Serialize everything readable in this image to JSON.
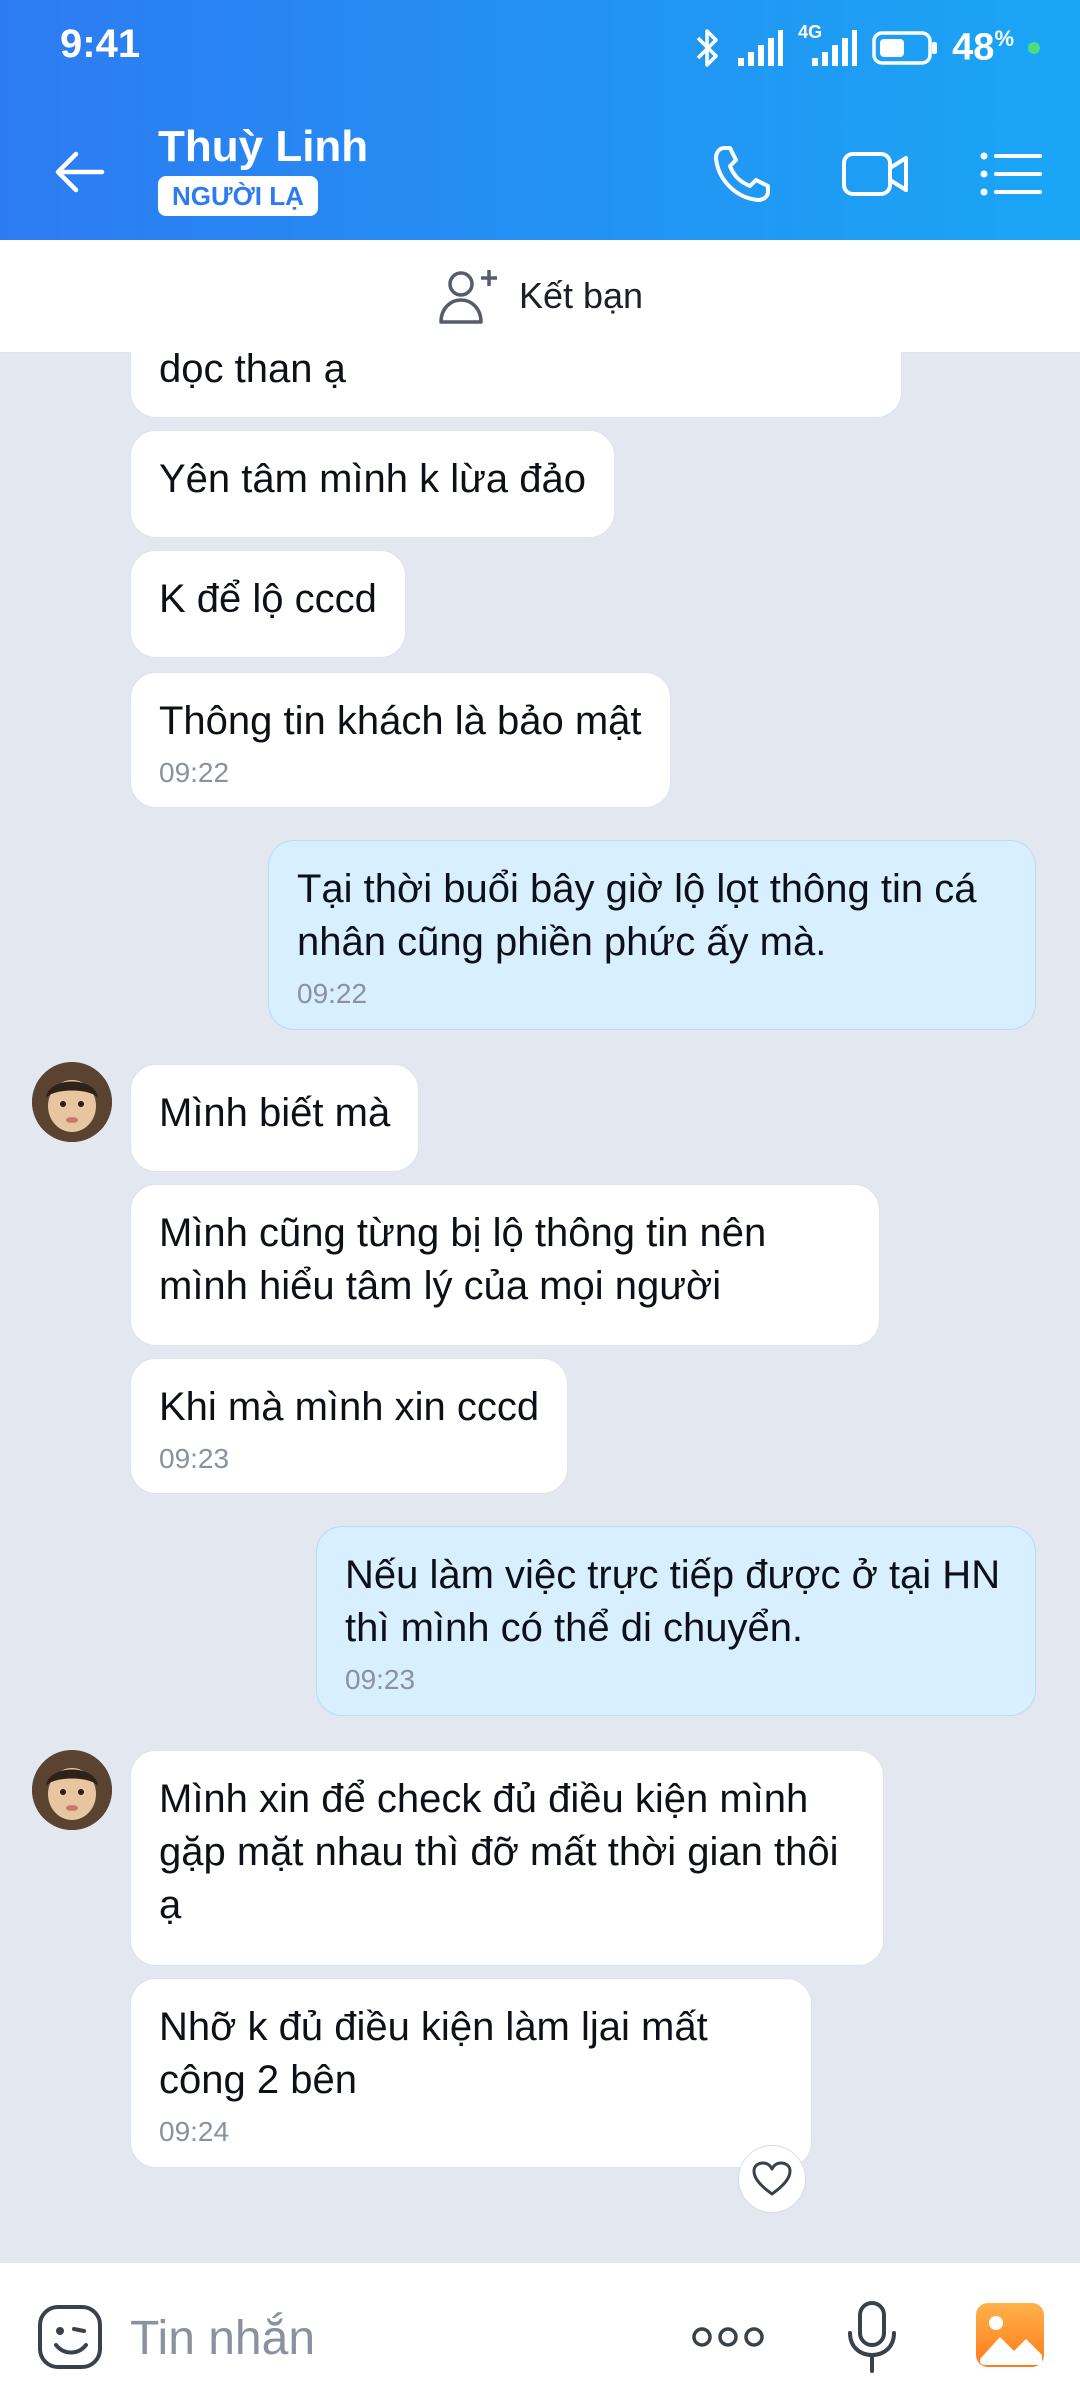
{
  "status": {
    "time": "9:41",
    "network": "4G",
    "battery": "48",
    "battery_unit": "%"
  },
  "header": {
    "contact_name": "Thuỳ Linh",
    "badge": "NGƯỜI LẠ"
  },
  "friend_bar": {
    "label": "Kết bạn"
  },
  "messages": [
    {
      "side": "recv",
      "text": "dọc than ạ"
    },
    {
      "side": "recv",
      "text": "Yên tâm mình k lừa đảo"
    },
    {
      "side": "recv",
      "text": "K để lộ cccd"
    },
    {
      "side": "recv",
      "text": "Thông tin khách là bảo mật",
      "time": "09:22"
    },
    {
      "side": "sent",
      "text": "Tại thời buổi bây giờ lộ lọt thông tin cá nhân cũng phiền phức ấy mà.",
      "time": "09:22"
    },
    {
      "side": "recv",
      "text": "Mình biết mà"
    },
    {
      "side": "recv",
      "text": "Mình cũng từng bị lộ thông tin nên mình hiểu tâm lý của mọi người"
    },
    {
      "side": "recv",
      "text": "Khi mà mình xin cccd",
      "time": "09:23"
    },
    {
      "side": "sent",
      "text": "Nếu làm việc trực tiếp được ở tại HN thì mình có thể di chuyển.",
      "time": "09:23"
    },
    {
      "side": "recv",
      "text": "Mình xin để check đủ điều kiện mình gặp mặt nhau thì đỡ mất thời gian thôi ạ"
    },
    {
      "side": "recv",
      "text": "Nhỡ k đủ điều kiện làm ljai mất công 2 bên",
      "time": "09:24"
    }
  ],
  "input": {
    "placeholder": "Tin nhắn"
  },
  "icons": [
    "back-arrow-icon",
    "phone-icon",
    "video-call-icon",
    "menu-list-icon",
    "add-friend-icon",
    "heart-icon",
    "emoji-icon",
    "more-dots-icon",
    "microphone-icon",
    "image-icon",
    "bluetooth-icon",
    "signal-icon",
    "battery-icon"
  ],
  "colors": {
    "header_start": "#2d7bf2",
    "header_end": "#1aa6f5",
    "sent_bubble": "#d7efff",
    "received_bubble": "#ffffff",
    "background": "#e3e8f0"
  }
}
